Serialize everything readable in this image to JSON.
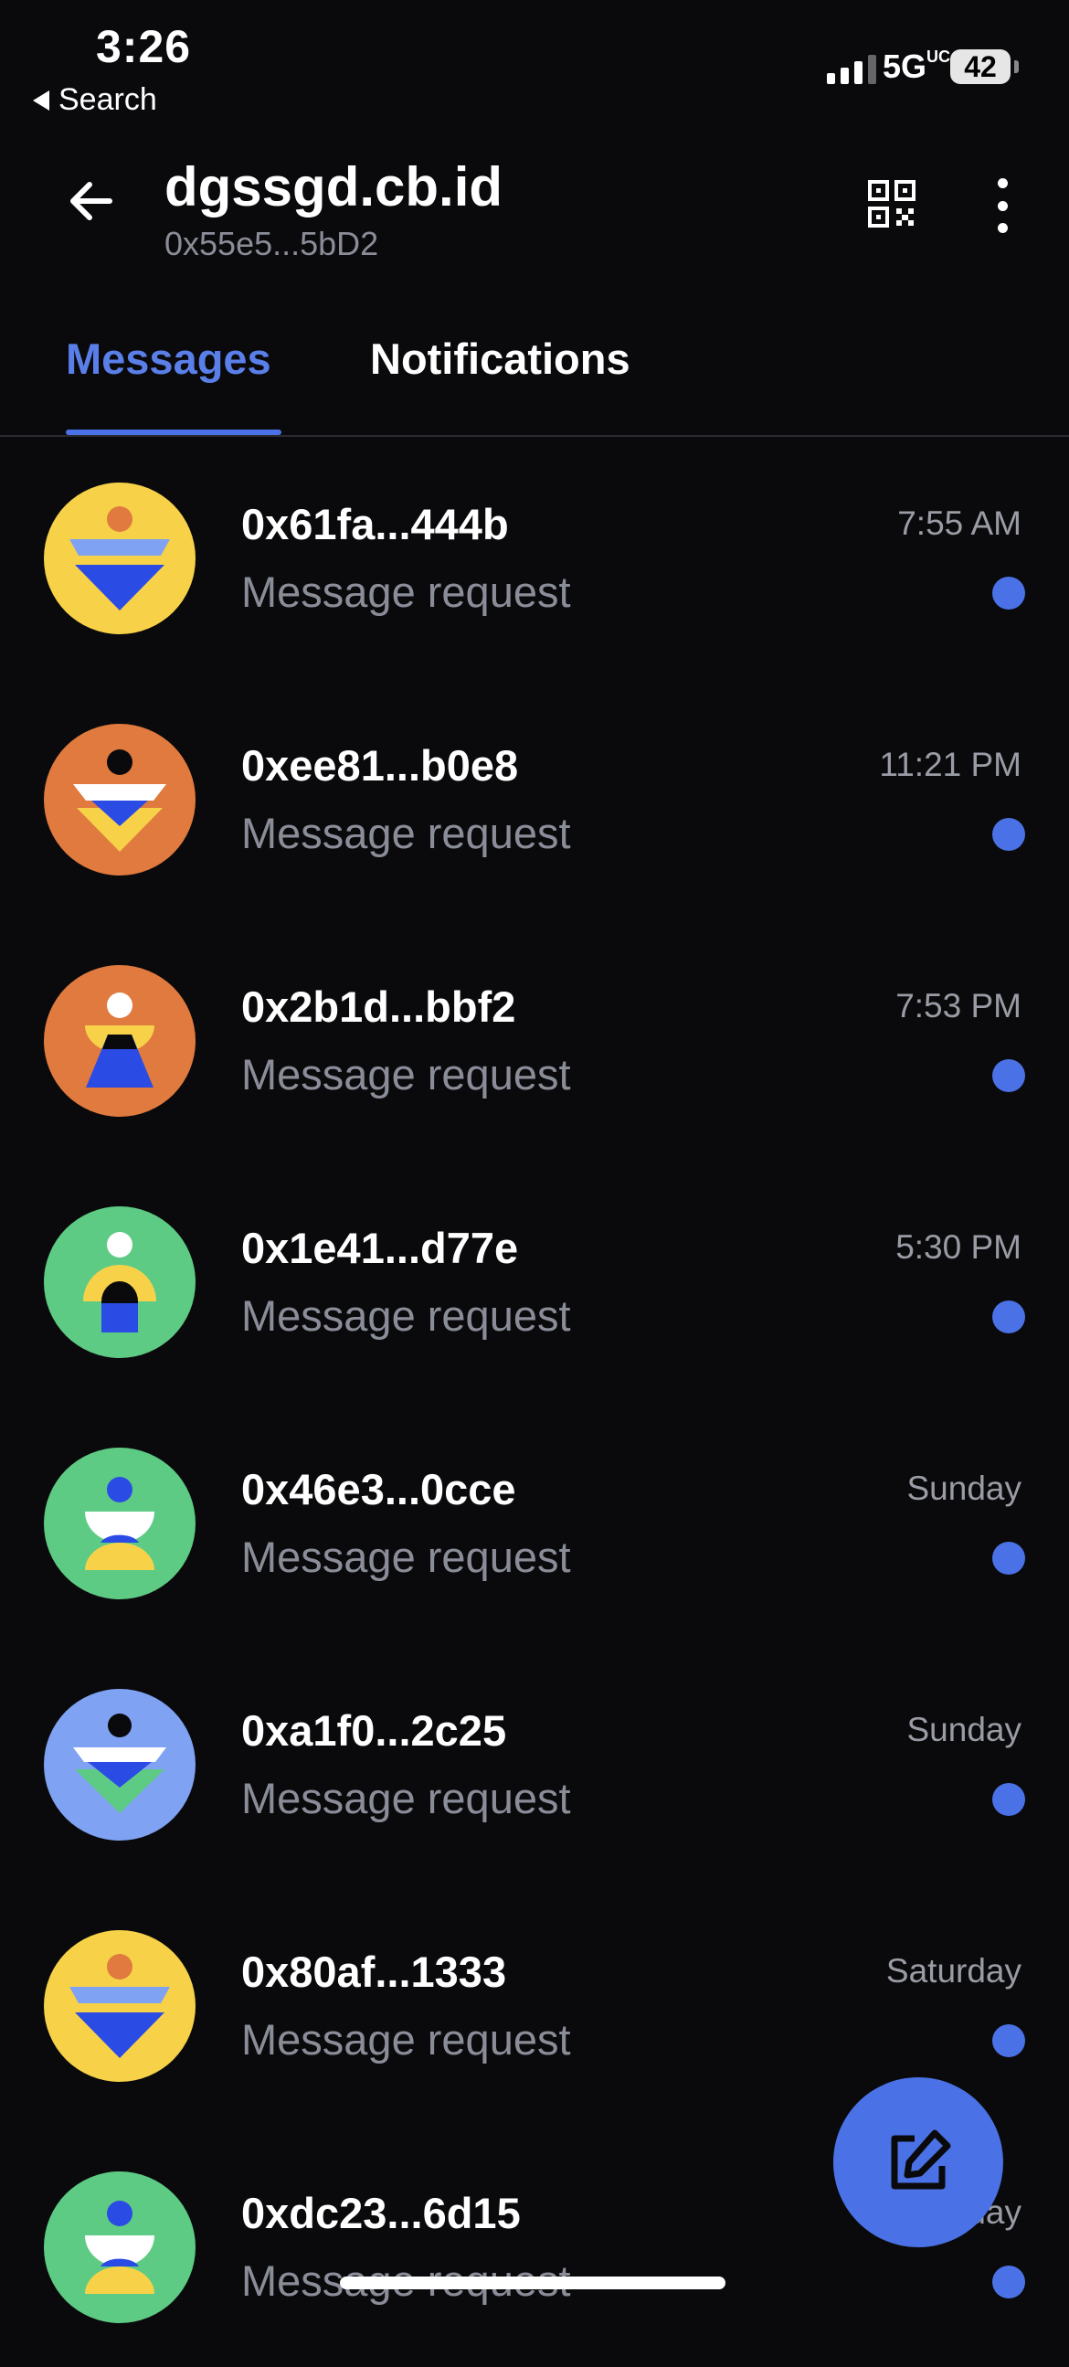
{
  "status_bar": {
    "time": "3:26",
    "back_app": "Search",
    "network": "5G",
    "network_sub": "UC",
    "battery": "42"
  },
  "header": {
    "title": "dgssgd.cb.id",
    "subtitle": "0x55e5...5bD2"
  },
  "tabs": [
    {
      "label": "Messages",
      "active": true
    },
    {
      "label": "Notifications",
      "active": false
    }
  ],
  "colors": {
    "accent": "#4a72e6",
    "background": "#0a0a0c",
    "muted_text": "#8a8d98"
  },
  "conversations": [
    {
      "address": "0x61fa...444b",
      "preview": "Message request",
      "time": "7:55 AM",
      "unread": true,
      "avatar": "yellow"
    },
    {
      "address": "0xee81...b0e8",
      "preview": "Message request",
      "time": "11:21 PM",
      "unread": true,
      "avatar": "orange-a"
    },
    {
      "address": "0x2b1d...bbf2",
      "preview": "Message request",
      "time": "7:53 PM",
      "unread": true,
      "avatar": "orange-b"
    },
    {
      "address": "0x1e41...d77e",
      "preview": "Message request",
      "time": "5:30 PM",
      "unread": true,
      "avatar": "green-a"
    },
    {
      "address": "0x46e3...0cce",
      "preview": "Message request",
      "time": "Sunday",
      "unread": true,
      "avatar": "green-b"
    },
    {
      "address": "0xa1f0...2c25",
      "preview": "Message request",
      "time": "Sunday",
      "unread": true,
      "avatar": "blue"
    },
    {
      "address": "0x80af...1333",
      "preview": "Message request",
      "time": "Saturday",
      "unread": true,
      "avatar": "yellow"
    },
    {
      "address": "0xdc23...6d15",
      "preview": "Message request",
      "time": "Saturday",
      "unread": true,
      "avatar": "green-b"
    }
  ],
  "icons": {
    "back": "arrow-left-icon",
    "qr": "qr-code-icon",
    "more": "more-vertical-icon",
    "compose": "compose-icon"
  }
}
